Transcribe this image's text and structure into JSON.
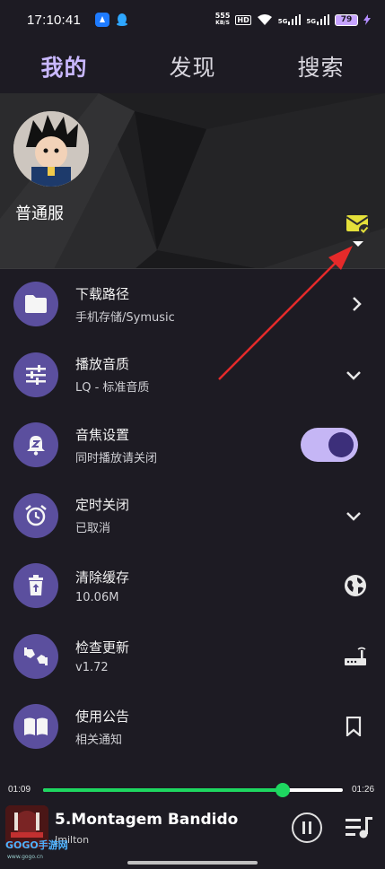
{
  "status_bar": {
    "time": "17:10:41",
    "speed_value": "555",
    "speed_unit": "KB/S",
    "hd_label": "HD",
    "network_1": "5G",
    "network_2": "5G",
    "battery": "79"
  },
  "tabs": [
    {
      "label": "我的",
      "active": true
    },
    {
      "label": "发现",
      "active": false
    },
    {
      "label": "搜索",
      "active": false
    }
  ],
  "profile": {
    "username": "普通服"
  },
  "settings": [
    {
      "title": "下载路径",
      "subtitle": "手机存储/Symusic",
      "icon": "folder-icon",
      "trailing": "chevron-right-icon"
    },
    {
      "title": "播放音质",
      "subtitle": "LQ - 标准音质",
      "icon": "equalizer-icon",
      "trailing": "chevron-down-icon"
    },
    {
      "title": "音焦设置",
      "subtitle": "同时播放请关闭",
      "icon": "bell-z-icon",
      "trailing": "toggle",
      "toggle_on": true
    },
    {
      "title": "定时关闭",
      "subtitle": "已取消",
      "icon": "alarm-icon",
      "trailing": "chevron-down-icon"
    },
    {
      "title": "清除缓存",
      "subtitle": "10.06M",
      "icon": "delete-icon",
      "trailing": "globe-icon"
    },
    {
      "title": "检查更新",
      "subtitle": "v1.72",
      "icon": "thumbs-icon",
      "trailing": "router-icon"
    },
    {
      "title": "使用公告",
      "subtitle": "相关通知",
      "icon": "book-icon",
      "trailing": "bookmark-icon"
    }
  ],
  "player": {
    "elapsed": "01:09",
    "total": "01:26",
    "progress": 0.8,
    "song_title": "5.Montagem Bandido",
    "artist": "Jmilton"
  },
  "watermark": {
    "brand": "GOGO手游网",
    "site": "www.gogo.cn"
  },
  "colors": {
    "accent": "#c9b8ff",
    "icon_circle": "#5b4f9e",
    "progress": "#1ed760",
    "mail": "#e4e03a"
  }
}
